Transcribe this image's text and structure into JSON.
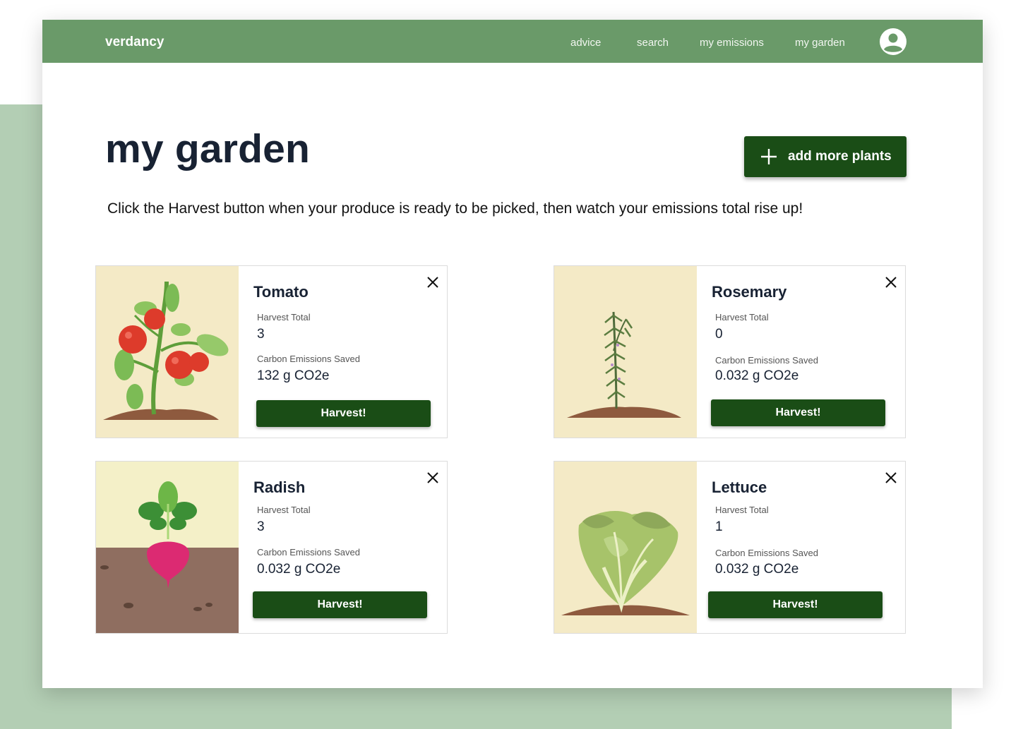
{
  "navbar": {
    "brand": "verdancy",
    "links": [
      "advice",
      "search",
      "my emissions",
      "my garden"
    ]
  },
  "page": {
    "title": "my garden",
    "add_button_label": "add more plants",
    "intro": "Click the Harvest button when your produce is ready to be picked, then watch your emissions total rise up!"
  },
  "labels": {
    "harvest_total": "Harvest Total",
    "carbon_saved": "Carbon Emissions Saved",
    "harvest_button": "Harvest!"
  },
  "plants": [
    {
      "name": "Tomato",
      "harvest_total": "3",
      "carbon_saved": "132 g CO2e",
      "icon": "tomato-plant"
    },
    {
      "name": "Rosemary",
      "harvest_total": "0",
      "carbon_saved": "0.032 g CO2e",
      "icon": "rosemary-plant"
    },
    {
      "name": "Radish",
      "harvest_total": "3",
      "carbon_saved": "0.032 g CO2e",
      "icon": "radish-plant"
    },
    {
      "name": "Lettuce",
      "harvest_total": "1",
      "carbon_saved": "0.032 g CO2e",
      "icon": "lettuce-plant"
    }
  ],
  "colors": {
    "navbar": "#6a9a69",
    "button": "#1a4d16",
    "title": "#182233",
    "background_block": "#b3ceb4",
    "image_bg": "#f4eac6"
  }
}
